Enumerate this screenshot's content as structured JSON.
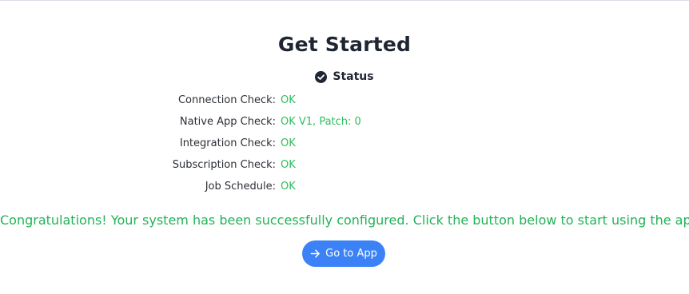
{
  "page": {
    "title": "Get Started"
  },
  "status": {
    "label": "Status",
    "icon": "check-circle-icon"
  },
  "checks": [
    {
      "name": "Connection Check:",
      "value": "OK"
    },
    {
      "name": "Native App Check:",
      "value": "OK V1, Patch: 0"
    },
    {
      "name": "Integration Check:",
      "value": "OK"
    },
    {
      "name": "Subscription Check:",
      "value": "OK"
    },
    {
      "name": "Job Schedule:",
      "value": "OK"
    }
  ],
  "message": "Congratulations! Your system has been successfully configured. Click the button below to start using the app.",
  "button": {
    "label": "Go to App",
    "icon": "arrow-right-icon"
  },
  "colors": {
    "ok_green": "#2ebd5f",
    "message_green": "#22b357",
    "button_blue": "#3b82f6",
    "title_dark": "#1f2633"
  }
}
